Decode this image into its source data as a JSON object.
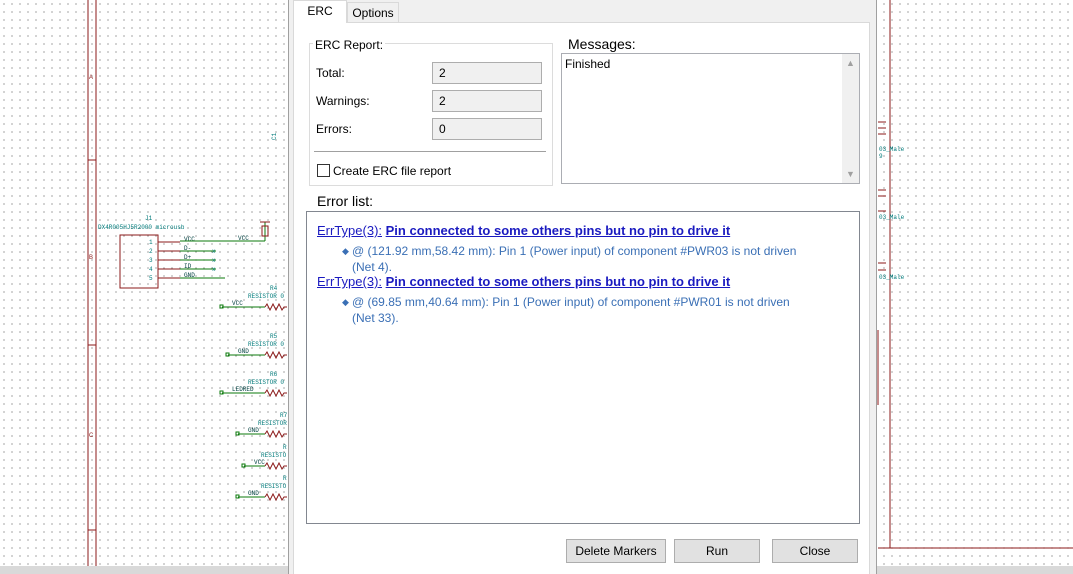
{
  "schematic": {
    "border_letters": [
      "A",
      "B",
      "C"
    ],
    "connector_ref": "J1",
    "connector_value": "DX4R005HJ5R2000 microusb",
    "pin_numbers": [
      "1",
      "2",
      "3",
      "4",
      "5"
    ],
    "pin_nets": [
      "VCC",
      "D-",
      "D+",
      "ID",
      "GND"
    ],
    "vcc_label": "VCC",
    "resistors": [
      {
        "ref": "R4",
        "value": "RESISTOR 0",
        "net": "VCC"
      },
      {
        "ref": "R5",
        "value": "RESISTOR 0",
        "net": "GND"
      },
      {
        "ref": "R6",
        "value": "RESISTOR 0",
        "net": "LEDRED"
      },
      {
        "ref": "R7",
        "value": "RESISTOR",
        "net": "GND"
      },
      {
        "ref": "R",
        "value": "RESISTO",
        "net": "VCC"
      },
      {
        "ref": "R",
        "value": "RESISTO",
        "net": "GND"
      }
    ],
    "right_labels": [
      "03_Male",
      "9",
      "03_Male",
      "03_Male"
    ],
    "rotated_label": "C1"
  },
  "dialog": {
    "tabs": [
      {
        "label": "ERC",
        "active": true
      },
      {
        "label": "Options",
        "active": false
      }
    ],
    "erc_report": {
      "title": "ERC Report:",
      "total_label": "Total:",
      "total_value": "2",
      "warnings_label": "Warnings:",
      "warnings_value": "2",
      "errors_label": "Errors:",
      "errors_value": "0",
      "checkbox_label": "Create ERC file report",
      "checkbox_checked": false
    },
    "messages": {
      "title": "Messages:",
      "text": "Finished"
    },
    "error_list": {
      "title": "Error list:",
      "items": [
        {
          "type": "ErrType(3):",
          "message": "Pin connected to some others pins but no pin to drive it",
          "detail_line1": "@ (121.92 mm,58.42 mm): Pin 1 (Power input) of component #PWR03 is not driven",
          "detail_line2": "(Net 4)."
        },
        {
          "type": "ErrType(3):",
          "message": "Pin connected to some others pins but no pin to drive it",
          "detail_line1": "@ (69.85 mm,40.64 mm): Pin 1 (Power input) of component #PWR01 is not driven",
          "detail_line2": "(Net 33)."
        }
      ]
    },
    "buttons": {
      "delete_markers": "Delete Markers",
      "run": "Run",
      "close": "Close"
    }
  },
  "colors": {
    "border_red": "#8b1a1a",
    "wire_green": "#0b7a0b",
    "component_red": "#8b1a1a",
    "label_teal": "#007a7a",
    "link_blue": "#1a1ac0",
    "detail_blue": "#3a6fb5"
  }
}
